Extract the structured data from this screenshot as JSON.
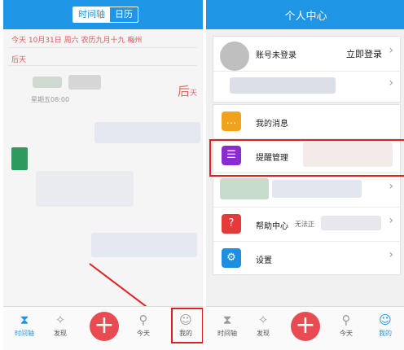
{
  "left": {
    "tabs": {
      "active": "时间轴",
      "other": "日历"
    },
    "date_line": "今天 10月31日 周六 农历九月十九 梅州",
    "section": "后天",
    "event_day": {
      "big": "后",
      "small": "天"
    },
    "event_time": "星期五08:00",
    "tabbar": [
      {
        "label": "时间轴",
        "icon": "hourglass-icon"
      },
      {
        "label": "发现",
        "icon": "lightbulb-icon"
      },
      {
        "label": "今天",
        "icon": "pin-icon"
      },
      {
        "label": "我的",
        "icon": "person-icon"
      }
    ]
  },
  "right": {
    "title": "个人中心",
    "account": {
      "label": "账号未登录",
      "action": "立即登录"
    },
    "menu": [
      {
        "label": "我的消息",
        "icon": "message-icon",
        "color": "#f0a21c"
      },
      {
        "label": "提醒管理",
        "icon": "clipboard-icon",
        "color": "#8a2bd0"
      },
      {
        "label": "帮助中心",
        "note": "无法正",
        "icon": "question-icon",
        "color": "#e53a3a"
      },
      {
        "label": "设置",
        "icon": "gear-icon",
        "color": "#1e8fe0"
      }
    ],
    "tabbar": [
      {
        "label": "时间轴",
        "icon": "hourglass-icon"
      },
      {
        "label": "发现",
        "icon": "lightbulb-icon"
      },
      {
        "label": "今天",
        "icon": "pin-icon"
      },
      {
        "label": "我的",
        "icon": "person-icon"
      }
    ]
  },
  "colors": {
    "brand_blue": "#1e95e5",
    "accent_red": "#e84c52",
    "highlight_red": "#e02020"
  }
}
